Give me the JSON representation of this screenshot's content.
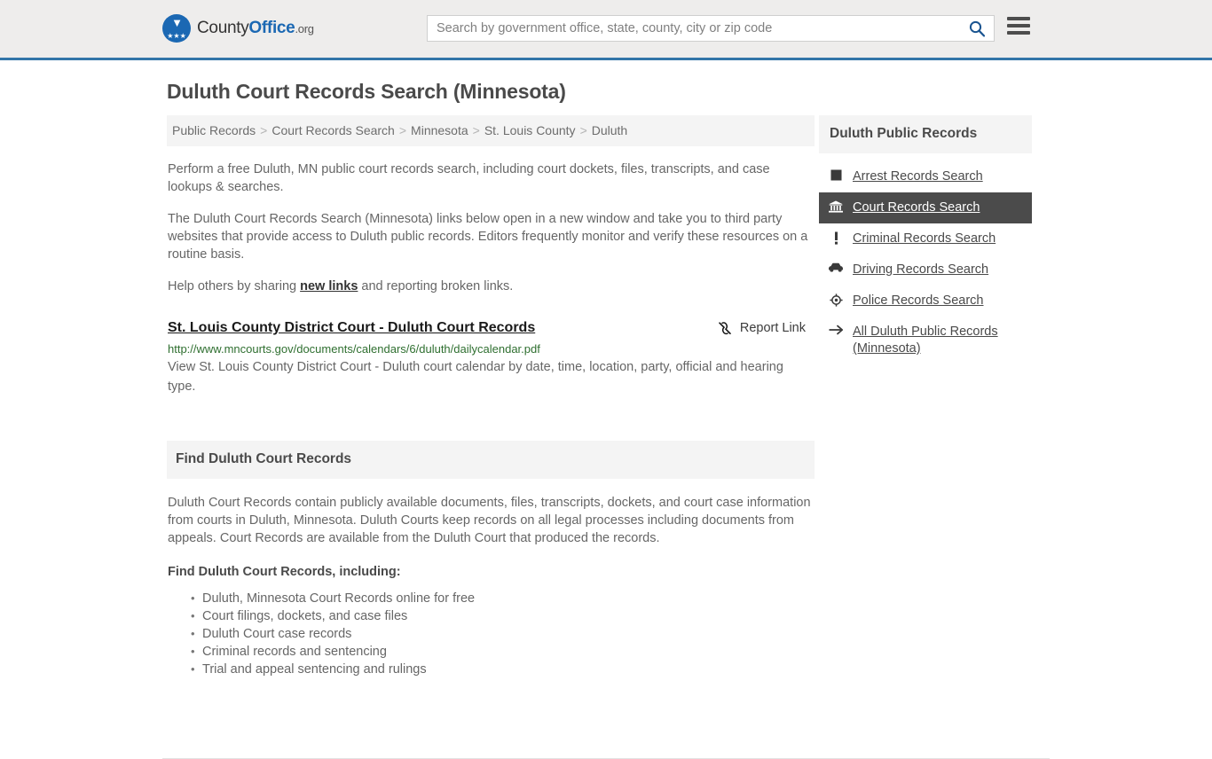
{
  "header": {
    "logo": {
      "name": "CountyOffice.org",
      "part1": "County",
      "part2": "Office",
      "part3": ".org",
      "icon": "eagle-shield-logo",
      "brand_color": "#1b68b3"
    },
    "search": {
      "placeholder": "Search by government office, state, county, city or zip code",
      "value": "",
      "icon": "search-icon",
      "icon_color": "#1a5490"
    },
    "menu": {
      "icon": "hamburger-menu-icon",
      "label": "Menu"
    },
    "border_color": "#3275a8",
    "background": "#eeedec"
  },
  "page_title": "Duluth Court Records Search (Minnesota)",
  "breadcrumb": {
    "separator": ">",
    "items": [
      {
        "label": "Public Records"
      },
      {
        "label": "Court Records Search"
      },
      {
        "label": "Minnesota"
      },
      {
        "label": "St. Louis County"
      },
      {
        "label": "Duluth"
      }
    ]
  },
  "intro": {
    "p1": "Perform a free Duluth, MN public court records search, including court dockets, files, transcripts, and case lookups & searches.",
    "p2": "The Duluth Court Records Search (Minnesota) links below open in a new window and take you to third party websites that provide access to Duluth public records. Editors frequently monitor and verify these resources on a routine basis.",
    "p3_before": "Help others by sharing ",
    "p3_link": "new links",
    "p3_after": " and reporting broken links."
  },
  "result": {
    "title": "St. Louis County District Court - Duluth Court Records",
    "url": "http://www.mncourts.gov/documents/calendars/6/duluth/dailycalendar.pdf",
    "description": "View St. Louis County District Court - Duluth court calendar by date, time, location, party, official and hearing type.",
    "report": {
      "label": "Report Link",
      "icon": "broken-link-icon"
    },
    "url_color": "#2f6f30"
  },
  "panel": {
    "heading": "Find Duluth Court Records",
    "paragraph": "Duluth Court Records contain publicly available documents, files, transcripts, dockets, and court case information from courts in Duluth, Minnesota. Duluth Courts keep records on all legal processes including documents from appeals. Court Records are available from the Duluth Court that produced the records.",
    "subheading": "Find Duluth Court Records, including:",
    "list": [
      "Duluth, Minnesota Court Records online for free",
      "Court filings, dockets, and case files",
      "Duluth Court case records",
      "Criminal records and sentencing",
      "Trial and appeal sentencing and rulings"
    ]
  },
  "sidebar": {
    "heading": "Duluth Public Records",
    "active_bg": "#4b4b4b",
    "items": [
      {
        "label": "Arrest Records Search",
        "icon": "fingerprint-icon",
        "active": false
      },
      {
        "label": "Court Records Search",
        "icon": "courthouse-icon",
        "active": true
      },
      {
        "label": "Criminal Records Search",
        "icon": "exclamation-icon",
        "active": false
      },
      {
        "label": "Driving Records Search",
        "icon": "car-icon",
        "active": false
      },
      {
        "label": "Police Records Search",
        "icon": "police-badge-icon",
        "active": false
      },
      {
        "label": "All Duluth Public Records (Minnesota)",
        "icon": "arrow-right-icon",
        "active": false
      }
    ]
  }
}
